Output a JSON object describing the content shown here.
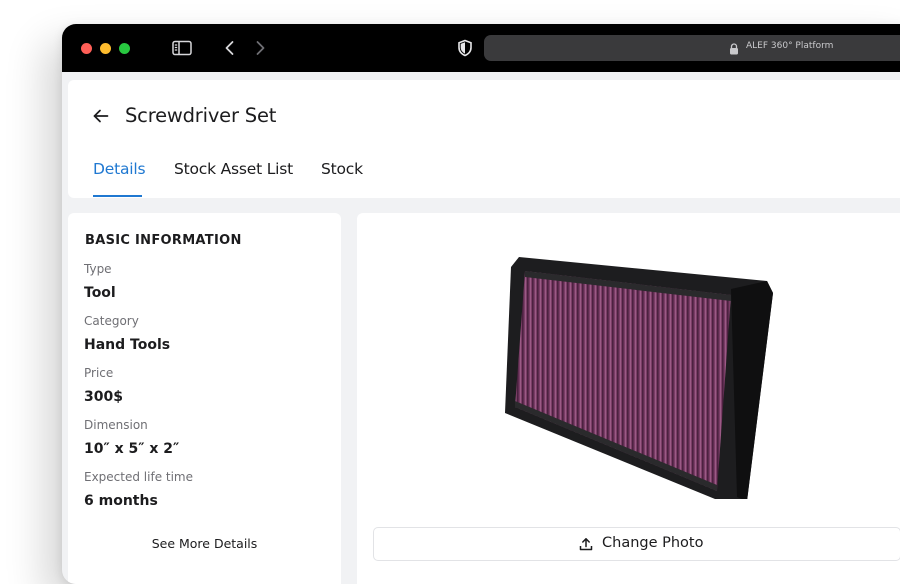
{
  "browser": {
    "url_text": "ALEF 360° Platform"
  },
  "page": {
    "title": "Screwdriver Set",
    "tabs": [
      {
        "label": "Details",
        "active": true
      },
      {
        "label": "Stock Asset List",
        "active": false
      },
      {
        "label": "Stock",
        "active": false
      }
    ]
  },
  "basic_info": {
    "section_title": "BASIC INFORMATION",
    "fields": [
      {
        "label": "Type",
        "value": "Tool"
      },
      {
        "label": "Category",
        "value": "Hand Tools"
      },
      {
        "label": "Price",
        "value": "300$"
      },
      {
        "label": "Dimension",
        "value": "10″ x 5″ x 2″"
      },
      {
        "label": "Expected life time",
        "value": "6 months"
      }
    ],
    "see_more_label": "See More Details"
  },
  "photo": {
    "change_photo_label": "Change Photo"
  },
  "colors": {
    "accent": "#1f78d1",
    "titlebar": "#000000",
    "filter_frame": "#1d1d1f",
    "filter_media": "#7a3d66"
  }
}
